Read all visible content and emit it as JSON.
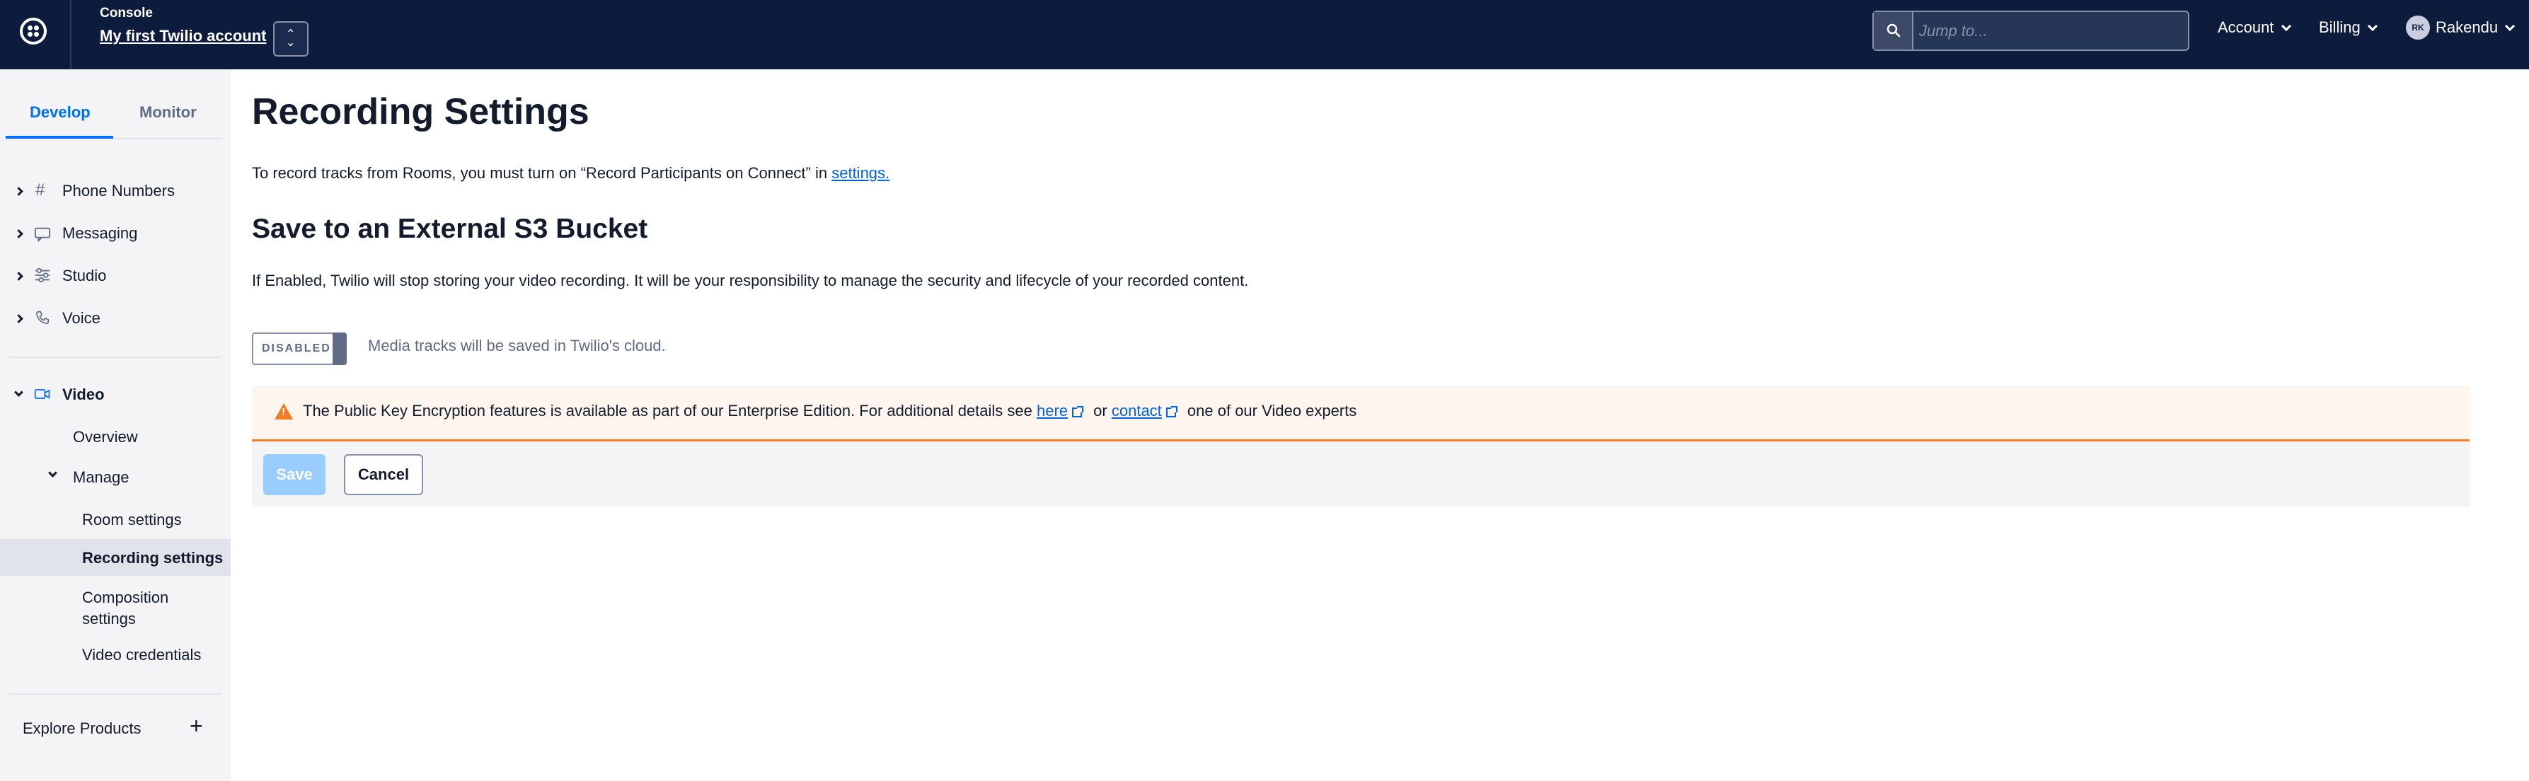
{
  "topbar": {
    "console_label": "Console",
    "account_name": "My first Twilio account",
    "search_placeholder": "Jump to...",
    "account_menu": "Account",
    "billing_menu": "Billing",
    "user_initials": "RK",
    "user_name": "Rakendu"
  },
  "sidebar": {
    "tabs": [
      "Develop",
      "Monitor"
    ],
    "active_tab": "Develop",
    "items": [
      {
        "label": "Phone Numbers",
        "icon": "hash-icon"
      },
      {
        "label": "Messaging",
        "icon": "chat-bubble-icon"
      },
      {
        "label": "Studio",
        "icon": "studio-flow-icon"
      },
      {
        "label": "Voice",
        "icon": "phone-icon"
      }
    ],
    "video": {
      "label": "Video",
      "overview": "Overview",
      "manage": "Manage",
      "sub_items": [
        "Room settings",
        "Recording settings",
        "Composition settings",
        "Video credentials"
      ],
      "active": "Recording settings"
    },
    "explore_products": "Explore Products"
  },
  "main": {
    "title": "Recording Settings",
    "intro_text": "To record tracks from Rooms, you must turn on “Record Participants on Connect” in ",
    "intro_link": "settings.",
    "section_title": "Save to an External S3 Bucket",
    "description": "If Enabled, Twilio will stop storing your video recording. It will be your responsibility to manage the security and lifecycle of your recorded content.",
    "toggle_label": "DISABLED",
    "toggle_caption": "Media tracks will be saved in Twilio's cloud.",
    "alert": {
      "text_before": "The Public Key Encryption features is available as part of our Enterprise Edition. For additional details see ",
      "link_here": "here",
      "text_or": "or",
      "link_contact": "contact",
      "text_after": "one of our Video experts"
    },
    "save_button": "Save",
    "cancel_button": "Cancel"
  },
  "colors": {
    "topbar_bg": "#0d1c3d",
    "link": "#0263e0",
    "accent": "#006dfa",
    "warning": "#f47c22"
  }
}
